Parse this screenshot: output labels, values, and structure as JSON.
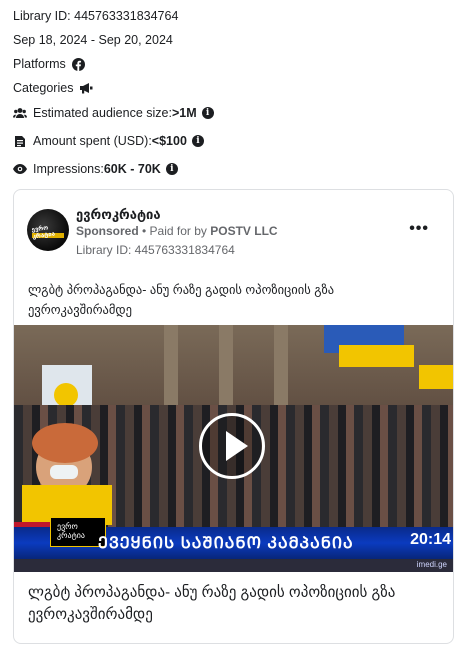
{
  "library_id": "Library ID: 445763331834764",
  "date_range": "Sep 18, 2024 - Sep 20, 2024",
  "platforms_label": "Platforms",
  "categories_label": "Categories",
  "audience": {
    "label": "Estimated audience size: ",
    "value": ">1M"
  },
  "spent": {
    "label": "Amount spent (USD): ",
    "value": "<$100"
  },
  "impressions": {
    "label": "Impressions: ",
    "value": "60K - 70K"
  },
  "info_glyph": "i",
  "ad": {
    "page_name": "ევროკრატია",
    "sponsored": "Sponsored",
    "dot": " • ",
    "paid_for_by": "Paid for by ",
    "payer": "POSTV LLC",
    "library_id": "Library ID: 445763331834764",
    "more": "•••",
    "body": "ლგბტ პროპაგანდა- ანუ რაზე გადის ოპოზიციის გზა ევროკავშირამდე",
    "caption": "ლგბტ პროპაგანდა- ანუ რაზე გადის ოპოზიციის გზა ევროკავშირამდე",
    "avatar_text": "ევრო კრატია",
    "video": {
      "ticker": "ᲔᲕᲔᲧᲜᲘᲡ ᲡᲐᲨᲘᲐᲜᲝ ᲙᲐᲛᲞᲐᲜᲘᲐ",
      "time": "20:14",
      "site": "imedi.ge",
      "logo": "ევრო კრატია"
    }
  },
  "colors": {
    "text": "#1c1e21",
    "muted": "#65676b",
    "border": "#dddfe2",
    "ticker_blue": "#0b3bbf",
    "flag_yellow": "#f2c500"
  },
  "icons": [
    "facebook-icon",
    "megaphone-icon",
    "audience-icon",
    "billing-icon",
    "eye-icon",
    "info-icon",
    "play-icon",
    "more-icon"
  ]
}
